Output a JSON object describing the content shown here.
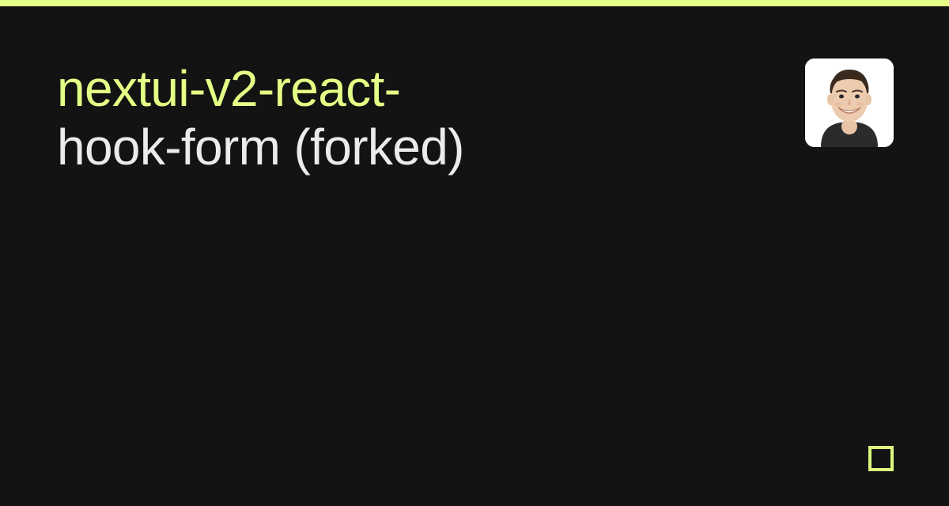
{
  "accent_color": "#E4FF85",
  "background_color": "#131313",
  "title": {
    "accent_segment": "nextui-v2-react-",
    "plain_segment": "hook-form (forked)"
  }
}
